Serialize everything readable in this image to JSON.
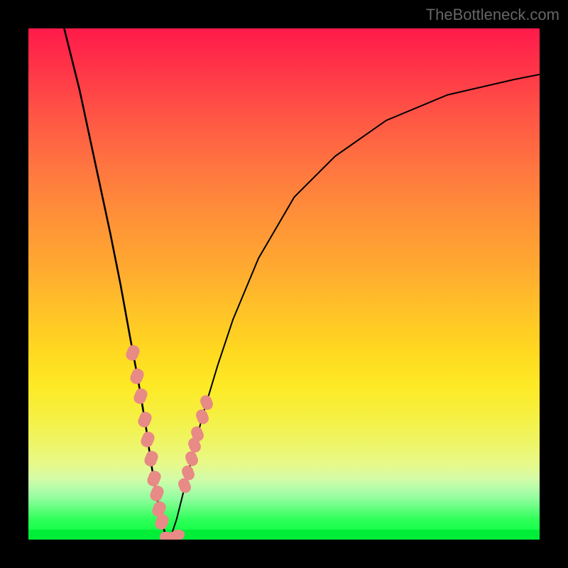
{
  "watermark": "TheBottleneck.com",
  "chart_data": {
    "type": "line",
    "title": "",
    "xlabel": "",
    "ylabel": "",
    "xlim": [
      0,
      100
    ],
    "ylim": [
      0,
      100
    ],
    "curve_left": {
      "x": [
        7,
        10,
        13,
        16,
        18,
        20,
        21.5,
        23,
        24,
        25,
        25.8,
        26.5,
        27,
        27.3
      ],
      "y": [
        100,
        88,
        74,
        60,
        50,
        39,
        31,
        22,
        15,
        9,
        5,
        2,
        0.5,
        0
      ]
    },
    "curve_right": {
      "x": [
        27.3,
        28,
        29,
        30.5,
        32,
        34,
        37,
        40,
        45,
        52,
        60,
        70,
        82,
        95,
        100
      ],
      "y": [
        0,
        1,
        4,
        10,
        16,
        24,
        34,
        43,
        55,
        67,
        75,
        82,
        87,
        90,
        91
      ]
    },
    "beads_left": {
      "x": [
        20.4,
        21.3,
        22.0,
        22.8,
        23.4,
        24.0,
        24.6,
        25.1,
        25.6,
        26.1
      ],
      "y": [
        36.5,
        32.0,
        28.0,
        23.5,
        19.6,
        15.8,
        12.0,
        9.0,
        6.0,
        3.5
      ]
    },
    "beads_right": {
      "x": [
        30.5,
        31.2,
        31.9,
        32.5,
        33.1,
        34.0,
        34.8
      ],
      "y": [
        10.5,
        13.0,
        15.8,
        18.5,
        20.7,
        24.0,
        26.8
      ]
    },
    "beads_bottom": {
      "x": [
        27.0,
        27.8,
        28.6,
        29.3
      ],
      "y": [
        0.6,
        0.4,
        0.6,
        1.0
      ]
    },
    "colors": {
      "curve": "#000000",
      "bead": "#e88a85"
    }
  }
}
